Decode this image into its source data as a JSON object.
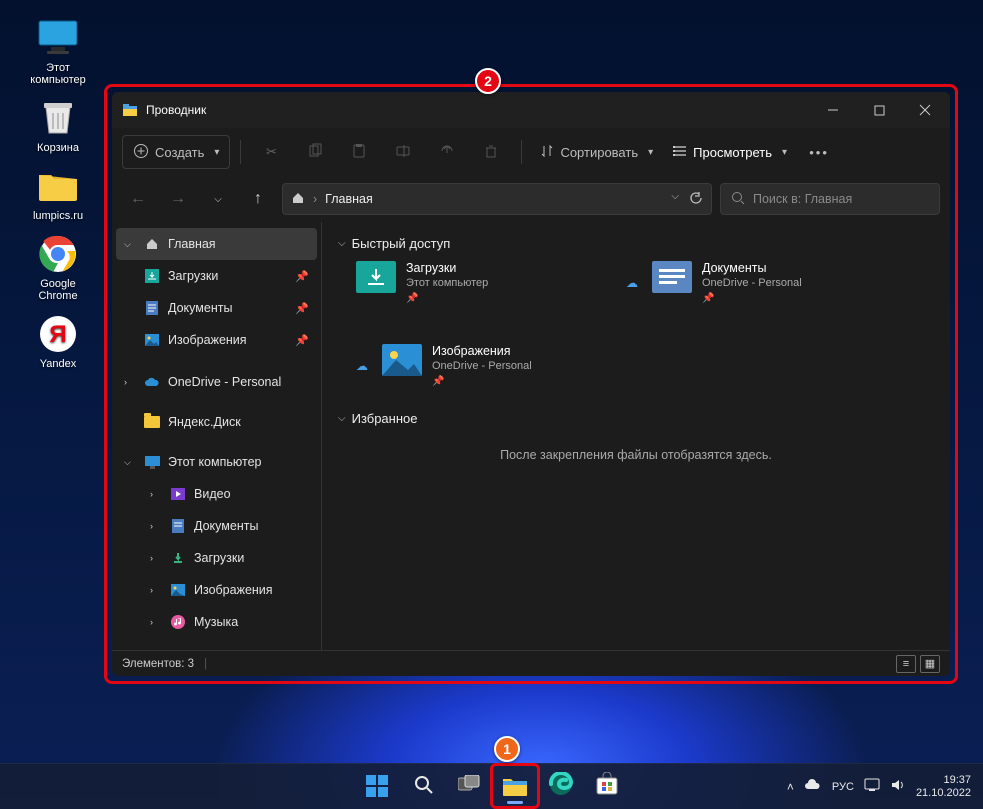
{
  "desktop": {
    "icons": [
      {
        "name": "this-pc",
        "label": "Этот\nкомпьютер"
      },
      {
        "name": "recycle-bin",
        "label": "Корзина"
      },
      {
        "name": "lumpics",
        "label": "lumpics.ru"
      },
      {
        "name": "chrome",
        "label": "Google\nChrome"
      },
      {
        "name": "yandex",
        "label": "Yandex"
      }
    ]
  },
  "annotations": {
    "n1": "1",
    "n2": "2"
  },
  "explorer": {
    "title": "Проводник",
    "toolbar": {
      "create": "Создать",
      "sort": "Сортировать",
      "view": "Просмотреть"
    },
    "breadcrumb": {
      "root": "Главная"
    },
    "search_placeholder": "Поиск в: Главная",
    "sidebar": {
      "home": "Главная",
      "downloads": "Загрузки",
      "documents": "Документы",
      "pictures": "Изображения",
      "onedrive": "OneDrive - Personal",
      "yadisk": "Яндекс.Диск",
      "thispc": "Этот компьютер",
      "videos": "Видео",
      "documents2": "Документы",
      "downloads2": "Загрузки",
      "pictures2": "Изображения",
      "music": "Музыка"
    },
    "groups": {
      "quick": "Быстрый доступ",
      "fav": "Избранное"
    },
    "cards": {
      "downloads": {
        "title": "Загрузки",
        "sub": "Этот компьютер"
      },
      "documents": {
        "title": "Документы",
        "sub": "OneDrive - Personal"
      },
      "pictures": {
        "title": "Изображения",
        "sub": "OneDrive - Personal"
      }
    },
    "favorites_empty": "После закрепления файлы отобразятся здесь.",
    "status": "Элементов: 3"
  },
  "taskbar": {
    "lang": "РУС",
    "time": "19:37",
    "date": "21.10.2022"
  }
}
